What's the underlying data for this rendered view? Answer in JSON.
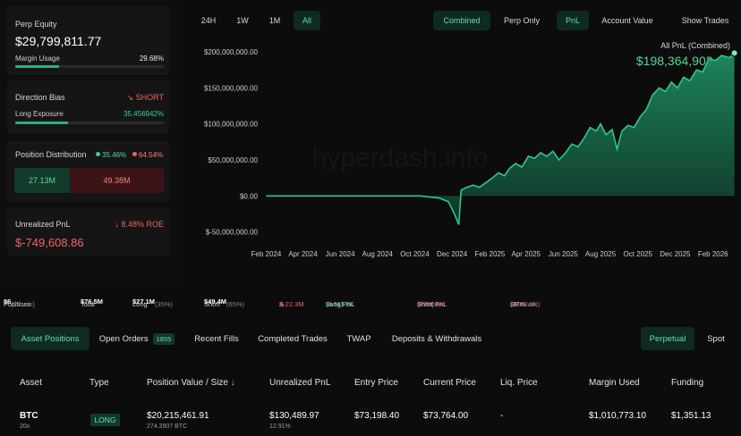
{
  "summary": {
    "perp_equity_label": "Perp Equity",
    "perp_equity_value": "$29,799,811.77",
    "margin_usage_label": "Margin Usage",
    "margin_usage_value": "29.68%",
    "margin_usage_fraction": 0.2968,
    "direction_bias_label": "Direction Bias",
    "direction_bias_value": "SHORT",
    "long_exposure_label": "Long Exposure",
    "long_exposure_value": "35.456942%",
    "long_exposure_fraction": 0.3546,
    "position_distribution_label": "Position Distribution",
    "long_pct": "35.46%",
    "short_pct": "64.54%",
    "long_value": "27.13M",
    "short_value": "49.38M",
    "unrealized_pnl_label": "Unrealized PnL",
    "roe_value": "8.48% ROE",
    "unrealized_pnl_value": "$-749,608.86"
  },
  "toolbar": {
    "range_24h": "24H",
    "range_1w": "1W",
    "range_1m": "1M",
    "range_all": "All",
    "combined": "Combined",
    "perp_only": "Perp Only",
    "pnl": "PnL",
    "account_value": "Account Value",
    "show_trades": "Show Trades"
  },
  "chart_header": {
    "title": "All PnL (Combined)",
    "value": "$198,364,903.60"
  },
  "watermark": "hyperdash.info",
  "chart_data": {
    "type": "area",
    "title": "All PnL (Combined)",
    "y_ticks": [
      "$200,000,000.00",
      "$150,000,000.00",
      "$100,000,000.00",
      "$50,000,000.00",
      "$0.00",
      "$-50,000,000.00"
    ],
    "y_tick_values": [
      200000000,
      150000000,
      100000000,
      50000000,
      0,
      -50000000
    ],
    "x_ticks": [
      "Feb 2024",
      "Apr 2024",
      "Jun 2024",
      "Aug 2024",
      "Oct 2024",
      "Dec 2024",
      "Feb 2025",
      "Apr 2025",
      "Jun 2025",
      "Aug 2025",
      "Oct 2025",
      "Dec 2025",
      "Feb 2026"
    ],
    "ylim": [
      -50000000,
      200000000
    ],
    "series": [
      {
        "values": [
          [
            "2024-02-01",
            0
          ],
          [
            "2024-10-10",
            0
          ],
          [
            "2024-11-10",
            -3000000
          ],
          [
            "2024-11-25",
            -8000000
          ],
          [
            "2024-12-05",
            -25000000
          ],
          [
            "2024-12-12",
            -40000000
          ],
          [
            "2024-12-16",
            8000000
          ],
          [
            "2024-12-25",
            12000000
          ],
          [
            "2025-01-05",
            15000000
          ],
          [
            "2025-01-15",
            12000000
          ],
          [
            "2025-01-25",
            18000000
          ],
          [
            "2025-02-05",
            25000000
          ],
          [
            "2025-02-15",
            32000000
          ],
          [
            "2025-02-25",
            28000000
          ],
          [
            "2025-03-05",
            38000000
          ],
          [
            "2025-03-15",
            45000000
          ],
          [
            "2025-03-25",
            40000000
          ],
          [
            "2025-04-05",
            55000000
          ],
          [
            "2025-04-15",
            52000000
          ],
          [
            "2025-04-25",
            60000000
          ],
          [
            "2025-05-05",
            55000000
          ],
          [
            "2025-05-15",
            62000000
          ],
          [
            "2025-05-25",
            50000000
          ],
          [
            "2025-06-05",
            60000000
          ],
          [
            "2025-06-15",
            72000000
          ],
          [
            "2025-06-25",
            68000000
          ],
          [
            "2025-07-05",
            80000000
          ],
          [
            "2025-07-15",
            95000000
          ],
          [
            "2025-07-25",
            90000000
          ],
          [
            "2025-08-01",
            100000000
          ],
          [
            "2025-08-10",
            85000000
          ],
          [
            "2025-08-20",
            92000000
          ],
          [
            "2025-08-28",
            65000000
          ],
          [
            "2025-09-05",
            90000000
          ],
          [
            "2025-09-15",
            98000000
          ],
          [
            "2025-09-25",
            95000000
          ],
          [
            "2025-10-05",
            110000000
          ],
          [
            "2025-10-15",
            120000000
          ],
          [
            "2025-10-25",
            140000000
          ],
          [
            "2025-11-05",
            150000000
          ],
          [
            "2025-11-15",
            145000000
          ],
          [
            "2025-11-25",
            158000000
          ],
          [
            "2025-12-05",
            150000000
          ],
          [
            "2025-12-15",
            165000000
          ],
          [
            "2025-12-25",
            160000000
          ],
          [
            "2026-01-05",
            175000000
          ],
          [
            "2026-01-15",
            172000000
          ],
          [
            "2026-01-25",
            190000000
          ],
          [
            "2026-02-05",
            188000000
          ],
          [
            "2026-02-15",
            195000000
          ],
          [
            "2026-02-28",
            192000000
          ],
          [
            "2026-03-08",
            198364903.6
          ]
        ]
      }
    ],
    "line_color": "#2fc78a",
    "fill_color": "#1f8a5f",
    "grid": false
  },
  "stats": {
    "positions_label": "Positions",
    "positions_value": "86",
    "positions_sub": "(27 win)",
    "total_label": "Total",
    "total_value": "$76.5M",
    "long_label": "Long",
    "long_value": "$27.1M",
    "long_sub": "(35%)",
    "short_label": "Short",
    "short_value": "$49.4M",
    "short_sub": "(65%)",
    "delta_label": "Δ",
    "delta_value": "$-22.3M",
    "long_pnl_label": "Long PnL",
    "long_pnl_value": "$+211.0K",
    "long_pnl_sub": "(5.5x)",
    "short_pnl_label": "Short PnL",
    "short_pnl_value": "$-960.6K",
    "short_pnl_sub": "(6.6x)",
    "upnl_label": "UPnL",
    "upnl_value": "$-749.6K",
    "upnl_sub": "(31% win)"
  },
  "tabs": {
    "asset_positions": "Asset Positions",
    "open_orders": "Open Orders",
    "open_orders_count": "1855",
    "recent_fills": "Recent Fills",
    "completed_trades": "Completed Trades",
    "twap": "TWAP",
    "deposits": "Deposits & Withdrawals",
    "perpetual": "Perpetual",
    "spot": "Spot"
  },
  "table": {
    "headers": {
      "asset": "Asset",
      "type": "Type",
      "position_value": "Position Value / Size",
      "sort_arrow": "↓",
      "unrealized_pnl": "Unrealized PnL",
      "entry_price": "Entry Price",
      "current_price": "Current Price",
      "liq_price": "Liq. Price",
      "margin_used": "Margin Used",
      "funding": "Funding"
    },
    "rows": [
      {
        "asset": "BTC",
        "leverage": "20x",
        "type": "LONG",
        "position_value": "$20,215,461.91",
        "size": "274.3907 BTC",
        "unrealized_pnl": "$130,489.97",
        "roe": "12.91%",
        "entry_price": "$73,198.40",
        "current_price": "$73,764.00",
        "liq_price": "-",
        "margin_used": "$1,010,773.10",
        "funding": "$1,351.13"
      }
    ]
  }
}
